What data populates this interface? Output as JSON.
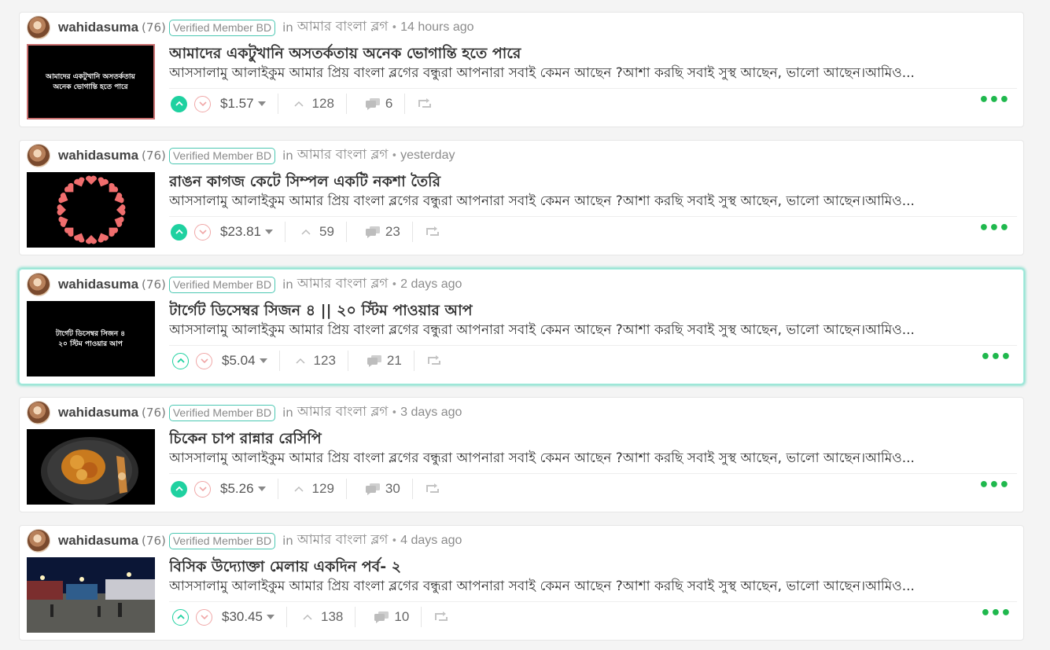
{
  "posts": [
    {
      "author": "wahidasuma",
      "reputation": "(76)",
      "badge": "Verified Member BD",
      "in_label": "in",
      "community": "আমার বাংলা ব্লগ",
      "separator": "•",
      "time": "14 hours ago",
      "title": "আমাদের একটুখানি অসতর্কতায় অনেক ভোগান্তি হতে পারে",
      "summary": "আসসালামু আলাইকুম আমার প্রিয় বাংলা ব্লগের বন্ধুরা আপনারা সবাই কেমন আছেন ?আশা করছি সবাই সুস্থ আছেন, ভালো আছেন।আমিও...",
      "payout": "$1.57",
      "votes": "128",
      "comments": "6",
      "upvoted": true,
      "thumbnail": {
        "kind": "text",
        "lines": [
          "আমাদের একটুখানি অসতর্কতায়",
          "অনেক ভোগান্তি হতে পারে"
        ],
        "border": "#c96f6f"
      }
    },
    {
      "author": "wahidasuma",
      "reputation": "(76)",
      "badge": "Verified Member BD",
      "in_label": "in",
      "community": "আমার বাংলা ব্লগ",
      "separator": "•",
      "time": "yesterday",
      "title": "রাঙন কাগজ কেটে সিম্পল একটি নকশা তৈরি",
      "summary": "আসসালামু আলাইকুম আমার প্রিয় বাংলা ব্লগের বন্ধুরা আপনারা সবাই কেমন আছেন ?আশা করছি সবাই সুস্থ আছেন, ভালো আছেন।আমিও...",
      "payout": "$23.81",
      "votes": "59",
      "comments": "23",
      "upvoted": true,
      "thumbnail": {
        "kind": "paper-design"
      }
    },
    {
      "author": "wahidasuma",
      "reputation": "(76)",
      "badge": "Verified Member BD",
      "in_label": "in",
      "community": "আমার বাংলা ব্লগ",
      "separator": "•",
      "time": "2 days ago",
      "title": "টার্গেট ডিসেম্বর সিজন ৪ || ২০ স্টিম পাওয়ার আপ",
      "summary": "আসসালামু আলাইকুম আমার প্রিয় বাংলা ব্লগের বন্ধুরা আপনারা সবাই কেমন আছেন ?আশা করছি সবাই সুস্থ আছেন, ভালো আছেন।আমিও...",
      "payout": "$5.04",
      "votes": "123",
      "comments": "21",
      "upvoted": false,
      "thumbnail": {
        "kind": "text",
        "lines": [
          "টার্গেট ডিসেম্বর সিজন ৪",
          "২০ স্টিম পাওয়ার আপ"
        ],
        "border": "#000000"
      }
    },
    {
      "author": "wahidasuma",
      "reputation": "(76)",
      "badge": "Verified Member BD",
      "in_label": "in",
      "community": "আমার বাংলা ব্লগ",
      "separator": "•",
      "time": "3 days ago",
      "title": "চিকেন চাপ রান্নার রেসিপি",
      "summary": "আসসালামু আলাইকুম আমার প্রিয় বাংলা ব্লগের বন্ধুরা আপনারা সবাই কেমন আছেন ?আশা করছি সবাই সুস্থ আছেন, ভালো আছেন।আমিও...",
      "payout": "$5.26",
      "votes": "129",
      "comments": "30",
      "upvoted": true,
      "thumbnail": {
        "kind": "food"
      }
    },
    {
      "author": "wahidasuma",
      "reputation": "(76)",
      "badge": "Verified Member BD",
      "in_label": "in",
      "community": "আমার বাংলা ব্লগ",
      "separator": "•",
      "time": "4 days ago",
      "title": "বিসিক উদ্যোক্তা মেলায় একদিন পর্ব- ২",
      "summary": "আসসালামু আলাইকুম আমার প্রিয় বাংলা ব্লগের বন্ধুরা আপনারা সবাই কেমন আছেন ?আশা করছি সবাই সুস্থ আছেন, ভালো আছেন।আমিও...",
      "payout": "$30.45",
      "votes": "138",
      "comments": "10",
      "upvoted": false,
      "thumbnail": {
        "kind": "fair-night"
      }
    }
  ],
  "colors": {
    "upvote": "#1fd1a0",
    "downvote": "#f0a7a7",
    "badge_border": "#4bc7b2",
    "active_glow": "#00c8a0",
    "more_dots": "#1fb84d"
  },
  "icons": [
    "upvote-icon",
    "downvote-icon",
    "caret-down-icon",
    "chevron-up-icon",
    "comments-icon",
    "reblog-icon",
    "more-icon"
  ]
}
